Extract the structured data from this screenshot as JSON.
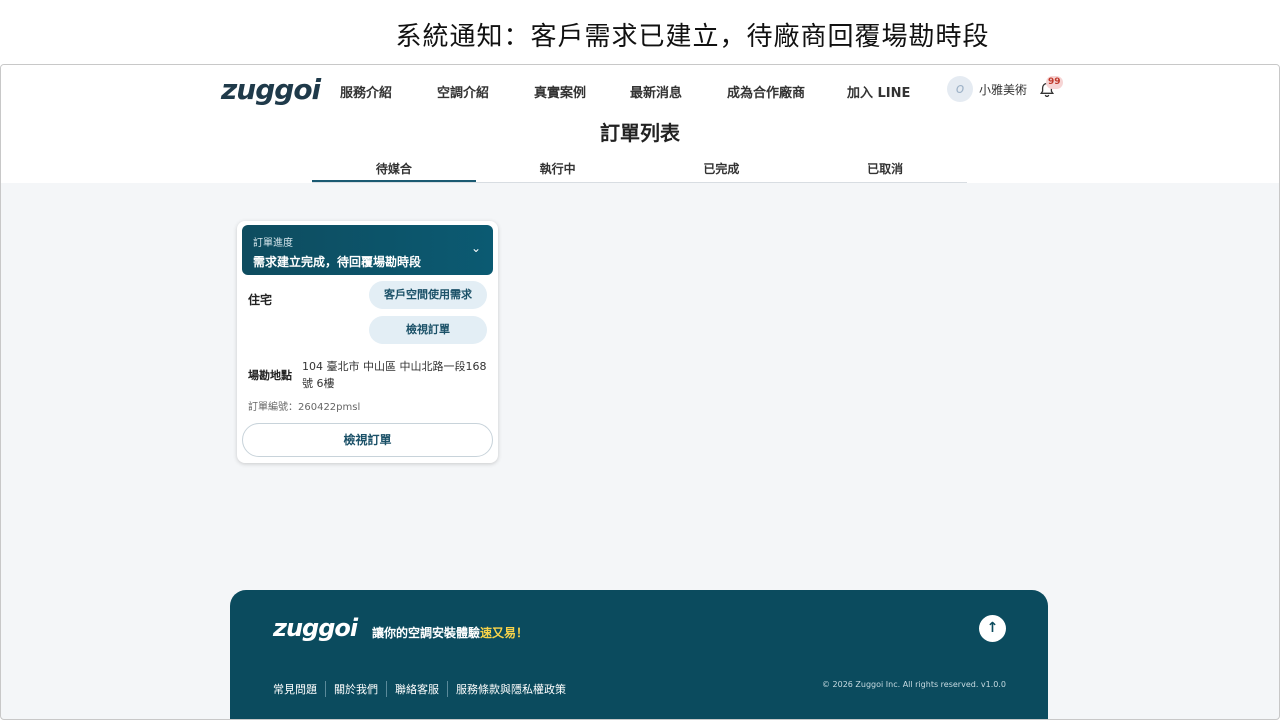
{
  "slide_title": "系統通知：客戶需求已建立，待廠商回覆場勘時段",
  "header": {
    "logo": "zuggoi",
    "nav": [
      "服務介紹",
      "空調介紹",
      "真實案例",
      "最新消息",
      "成為合作廠商",
      "加入 LINE"
    ],
    "user_name": "小雅美術",
    "notification_count": "99"
  },
  "page_title": "訂單列表",
  "tabs": [
    "待媒合",
    "執行中",
    "已完成",
    "已取消"
  ],
  "active_tab": "待媒合",
  "card": {
    "progress_label": "訂單進度",
    "status": "需求建立完成，待回覆場勘時段",
    "type": "住宅",
    "btn_needs": "客戶空間使用需求",
    "btn_view_small": "檢視訂單",
    "address_label": "場勘地點",
    "address": "104 臺北市 中山區 中山北路一段168號 6樓",
    "order_no": "訂單編號：260422pmsl",
    "btn_view": "檢視訂單"
  },
  "footer": {
    "logo": "zuggoi",
    "tagline_prefix": "讓你的空調安裝體驗",
    "tagline_highlight": "速又易！",
    "links": [
      "常見問題",
      "關於我們",
      "聯絡客服",
      "服務條款與隱私權政策"
    ],
    "copyright": "© 2026 Zuggoi Inc. All rights reserved. v1.0.0"
  },
  "colors": {
    "brand": "#0b4b5e",
    "highlight": "#f7d34a",
    "pill_bg": "#e3eef5"
  }
}
